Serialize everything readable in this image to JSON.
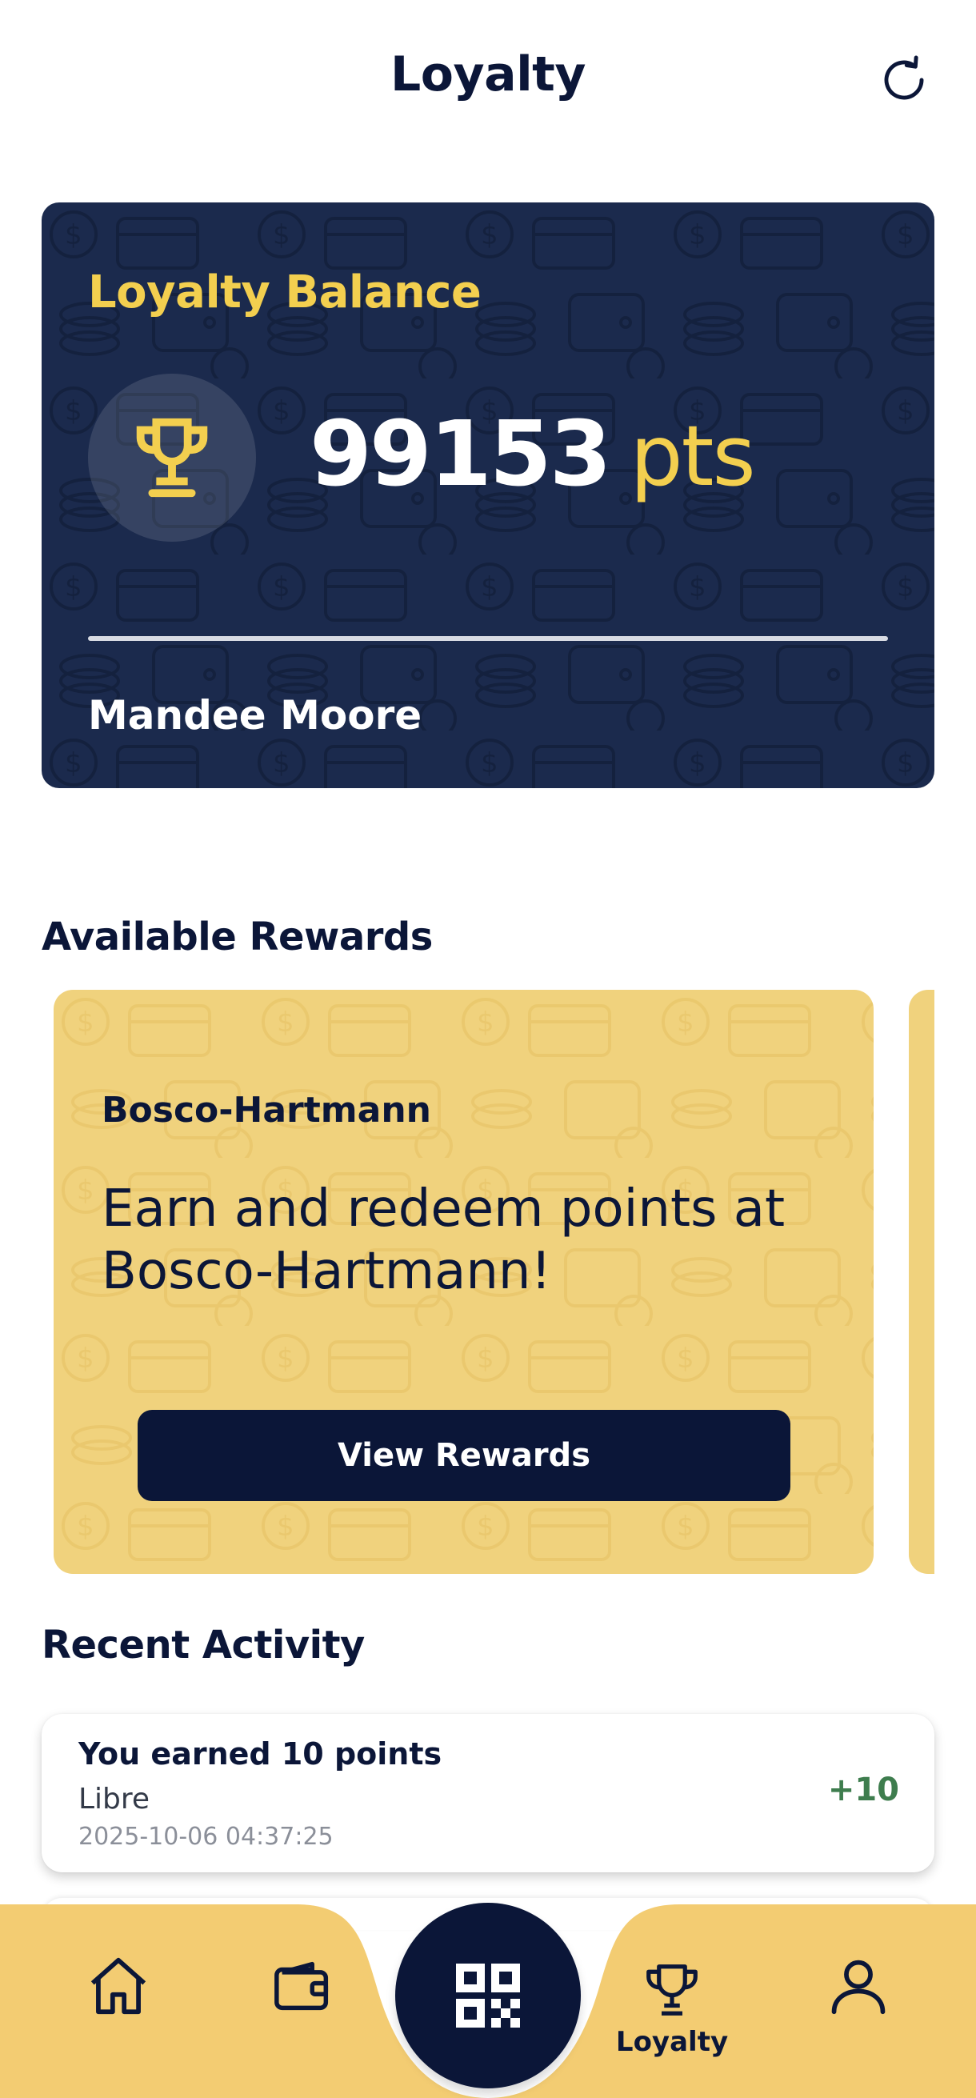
{
  "header": {
    "title": "Loyalty",
    "refresh_icon": "refresh-icon"
  },
  "balance_card": {
    "label": "Loyalty Balance",
    "points": "99153",
    "unit": "pts",
    "member_name": "Mandee Moore",
    "icon": "trophy-icon",
    "colors": {
      "background": "#1b2a4d",
      "accent": "#f3cf4f"
    }
  },
  "rewards": {
    "section_title": "Available Rewards",
    "items": [
      {
        "merchant": "Bosco-Hartmann",
        "description": "Earn and redeem points at Bosco-Hartmann!",
        "button_label": "View Rewards"
      }
    ],
    "colors": {
      "card": "#f0d27d"
    }
  },
  "activity": {
    "section_title": "Recent Activity",
    "items": [
      {
        "title": "You earned 10 points",
        "merchant": "Libre",
        "timestamp": "2025-10-06 04:37:25",
        "points": "+10"
      }
    ]
  },
  "nav": {
    "items": [
      {
        "icon": "home-icon",
        "label": ""
      },
      {
        "icon": "wallet-icon",
        "label": ""
      },
      {
        "icon": "qr-code-icon",
        "label": ""
      },
      {
        "icon": "trophy-icon",
        "label": "Loyalty",
        "active": true
      },
      {
        "icon": "profile-icon",
        "label": ""
      }
    ],
    "colors": {
      "bar": "#f3cc72",
      "scan": "#0b1638"
    }
  }
}
